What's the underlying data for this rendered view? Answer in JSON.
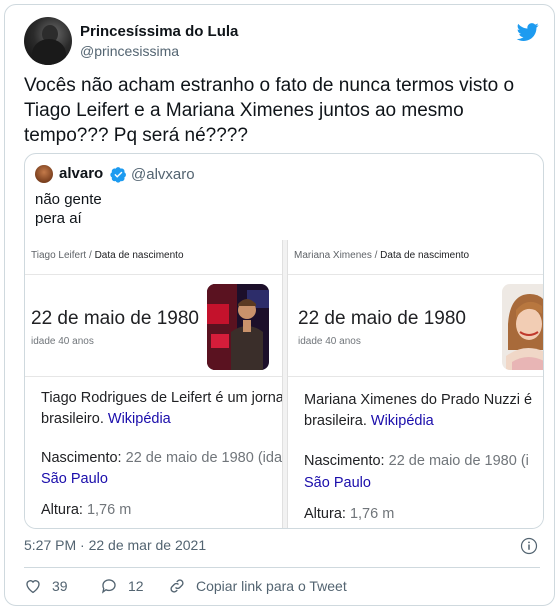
{
  "author": {
    "display_name": "Princesíssima do Lula",
    "handle": "@princesissima"
  },
  "tweet_text_lines": [
    "Vocês não acham estranho o fato de nunca termos visto o",
    "Tiago Leifert e a Mariana Ximenes juntos ao mesmo",
    "tempo??? Pq será né????"
  ],
  "quote": {
    "display_name": "alvaro",
    "handle": "@alvxaro",
    "text_lines": [
      "não gente",
      "pera aí"
    ],
    "cards": [
      {
        "crumb_name": "Tiago Leifert",
        "crumb_sep": "/",
        "crumb_title": "Data de nascimento",
        "date": "22 de maio de 1980",
        "age": "idade 40 anos",
        "desc_line1": "Tiago Rodrigues de Leifert é um jorna",
        "desc_line2": "brasileiro.",
        "desc_link": "Wikipédia",
        "birth_label": "Nascimento:",
        "birth_value": "22 de maio de 1980 (ida",
        "birth_place": "São Paulo",
        "height_label": "Altura:",
        "height_value": "1,76 m"
      },
      {
        "crumb_name": "Mariana Ximenes",
        "crumb_sep": "/",
        "crumb_title": "Data de nascimento",
        "date": "22 de maio de 1980",
        "age": "idade 40 anos",
        "desc_line1": "Mariana Ximenes do Prado Nuzzi é",
        "desc_line2": "brasileira.",
        "desc_link": "Wikipédia",
        "birth_label": "Nascimento:",
        "birth_value": "22 de maio de 1980 (i",
        "birth_place": "São Paulo",
        "height_label": "Altura:",
        "height_value": "1,76 m"
      }
    ]
  },
  "timestamp": "5:27 PM · 22 de mar de 2021",
  "actions": {
    "likes": "39",
    "replies": "12",
    "copy_link": "Copiar link para o Tweet"
  },
  "colors": {
    "twitter_blue": "#1d9bf0",
    "link_blue": "#1a0dab",
    "secondary_text": "#536471"
  }
}
